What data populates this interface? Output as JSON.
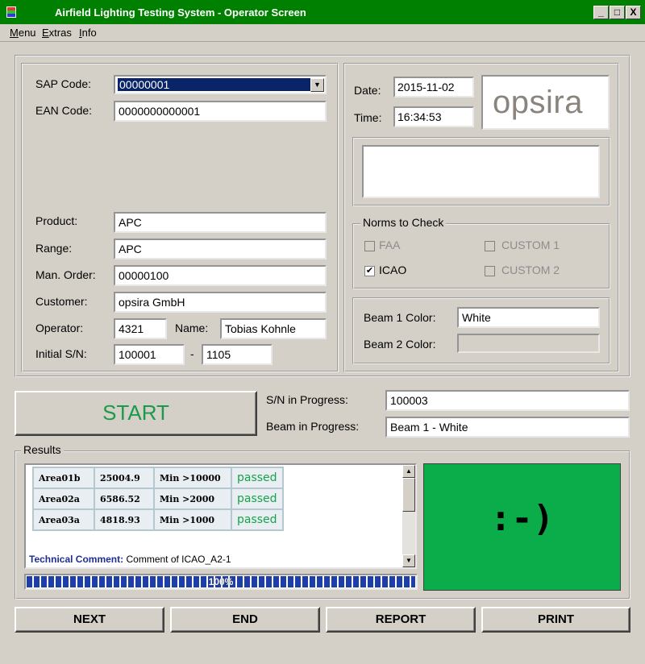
{
  "window": {
    "title": "Airfield Lighting Testing System - Operator Screen",
    "controls": [
      "_",
      "□",
      "X"
    ]
  },
  "menu": [
    "Menu",
    "Extras",
    "Info"
  ],
  "order": {
    "sap_label": "SAP Code:",
    "sap_value": "00000001",
    "ean_label": "EAN Code:",
    "ean_value": "0000000000001",
    "product_label": "Product:",
    "product_value": "APC",
    "range_label": "Range:",
    "range_value": "APC",
    "man_order_label": "Man. Order:",
    "man_order_value": "00000100",
    "customer_label": "Customer:",
    "customer_value": "opsira GmbH",
    "operator_label": "Operator:",
    "operator_value": "4321",
    "name_label": "Name:",
    "name_value": "Tobias Kohnle",
    "sn_label": "Initial S/N:",
    "sn_from": "100001",
    "sn_sep": "-",
    "sn_to": "1105"
  },
  "info": {
    "date_label": "Date:",
    "date_value": "2015-11-02",
    "time_label": "Time:",
    "time_value": "16:34:53",
    "logo_text": "opsira",
    "message": ""
  },
  "norms": {
    "title": "Norms to Check",
    "items": [
      {
        "label": "FAA",
        "checked": false,
        "enabled": false
      },
      {
        "label": "CUSTOM 1",
        "checked": false,
        "enabled": false
      },
      {
        "label": "ICAO",
        "checked": true,
        "enabled": true
      },
      {
        "label": "CUSTOM 2",
        "checked": false,
        "enabled": false
      }
    ],
    "check_mark": "✔"
  },
  "beams": {
    "beam1_label": "Beam 1 Color:",
    "beam1_value": "White",
    "beam2_label": "Beam 2 Color:",
    "beam2_value": ""
  },
  "progress": {
    "start_label": "START",
    "start_color": "#1a9a4a",
    "sn_label": "S/N in Progress:",
    "sn_value": "100003",
    "beam_label": "Beam in Progress:",
    "beam_value": "Beam 1 - White"
  },
  "results": {
    "title": "Results",
    "rows": [
      {
        "area": "Area01b",
        "value": "25004.9",
        "limit": "Min >10000",
        "status": "passed"
      },
      {
        "area": "Area02a",
        "value": "6586.52",
        "limit": "Min >2000",
        "status": "passed"
      },
      {
        "area": "Area03a",
        "value": "4818.93",
        "limit": "Min >1000",
        "status": "passed"
      }
    ],
    "comment_label": "Technical Comment:",
    "comment_text": "Comment of ICAO_A2-1",
    "progress_percent": 100,
    "progress_text": "100%",
    "smiley": ":-)",
    "status_color": "#0bad4a",
    "accent_color": "#1f2f8f"
  },
  "buttons": {
    "next": "NEXT",
    "end": "END",
    "report": "REPORT",
    "print": "PRINT"
  }
}
